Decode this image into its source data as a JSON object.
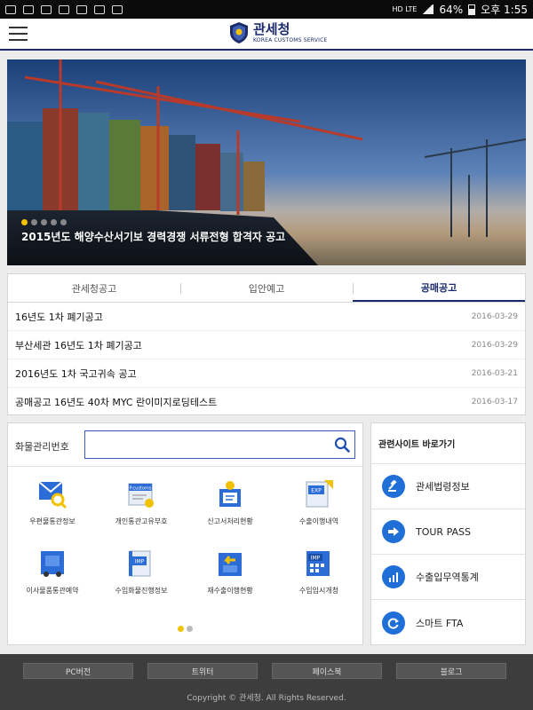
{
  "status_bar": {
    "network": "HD LTE",
    "battery": "64%",
    "time": "오후 1:55"
  },
  "header": {
    "logo_ko": "관세청",
    "logo_en": "KOREA CUSTOMS SERVICE",
    "brand_color": "#1a2a6c"
  },
  "banner": {
    "caption": "2015년도 해양수산서기보 경력경쟁 서류전형 합격자 공고",
    "slide_count": 5,
    "active_slide": 1
  },
  "notice": {
    "tabs": [
      {
        "label": "관세청공고",
        "active": false
      },
      {
        "label": "입안예고",
        "active": false
      },
      {
        "label": "공매공고",
        "active": true
      }
    ],
    "rows": [
      {
        "title": "16년도 1차 폐기공고",
        "date": "2016-03-29"
      },
      {
        "title": "부산세관 16년도 1차 폐기공고",
        "date": "2016-03-29"
      },
      {
        "title": "2016년도 1차 국고귀속 공고",
        "date": "2016-03-21"
      },
      {
        "title": "공매공고 16년도 40차 MYC 란이미지로딩테스트",
        "date": "2016-03-17"
      }
    ]
  },
  "cargo": {
    "label": "화물관리번호",
    "input_value": "",
    "placeholder": ""
  },
  "services": [
    {
      "label": "우편물통관정보",
      "icon": "mail-search-icon"
    },
    {
      "label": "개인통관고유부호",
      "icon": "personal-customs-code-icon",
      "icon_text": "P.customs"
    },
    {
      "label": "신고서처리현황",
      "icon": "declaration-status-icon"
    },
    {
      "label": "수출이행내역",
      "icon": "export-history-icon",
      "icon_text": "EXP"
    },
    {
      "label": "이사물품통관예약",
      "icon": "moving-truck-icon"
    },
    {
      "label": "수입화물진행정보",
      "icon": "import-cargo-icon",
      "icon_text": "IMP"
    },
    {
      "label": "재수출이행현황",
      "icon": "re-export-icon"
    },
    {
      "label": "수입임시개청",
      "icon": "import-temporary-icon",
      "icon_text": "IMP"
    }
  ],
  "services_pages": {
    "count": 2,
    "active": 1
  },
  "related": {
    "title": "관련사이트 바로가기",
    "items": [
      {
        "label": "관세법령정보",
        "icon": "gavel-icon"
      },
      {
        "label": "TOUR PASS",
        "icon": "arrow-right-icon"
      },
      {
        "label": "수출입무역통계",
        "icon": "bar-chart-icon"
      },
      {
        "label": "스마트 FTA",
        "icon": "refresh-icon"
      }
    ]
  },
  "footer": {
    "links": [
      "PC버전",
      "트위터",
      "페이스북",
      "블로그"
    ],
    "copyright": "Copyright © 관세청. All Rights Reserved."
  }
}
